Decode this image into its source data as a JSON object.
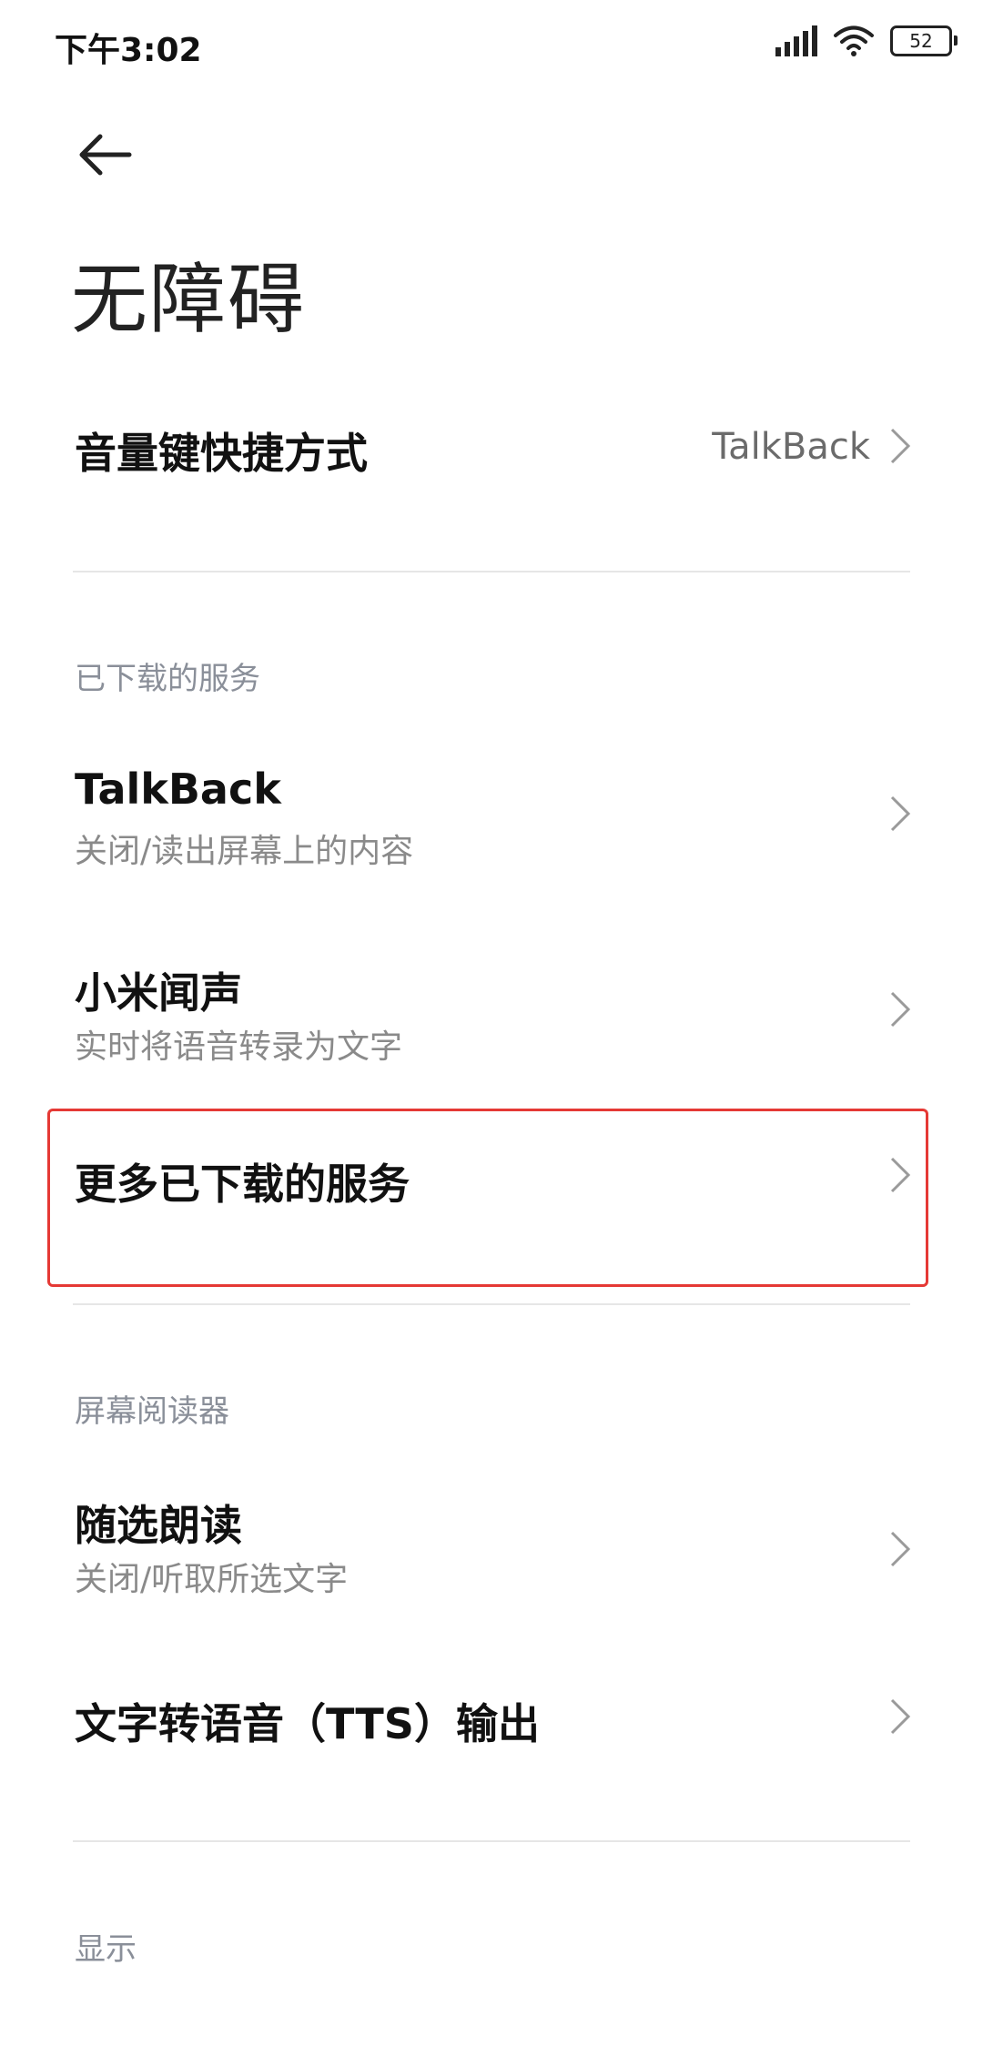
{
  "status_bar": {
    "time": "下午3:02",
    "battery": "52"
  },
  "header": {
    "title": "无障碍"
  },
  "items": {
    "volume_shortcut": {
      "title": "音量键快捷方式",
      "value": "TalkBack"
    },
    "talkback": {
      "title": "TalkBack",
      "subtitle": "关闭/读出屏幕上的内容"
    },
    "mi_voice": {
      "title": "小米闻声",
      "subtitle": "实时将语音转录为文字"
    },
    "more_services": {
      "title": "更多已下载的服务"
    },
    "select_to_speak": {
      "title": "随选朗读",
      "subtitle": "关闭/听取所选文字"
    },
    "tts_output": {
      "title": "文字转语音（TTS）输出"
    }
  },
  "sections": {
    "downloaded": "已下载的服务",
    "screen_reader": "屏幕阅读器",
    "display": "显示"
  }
}
